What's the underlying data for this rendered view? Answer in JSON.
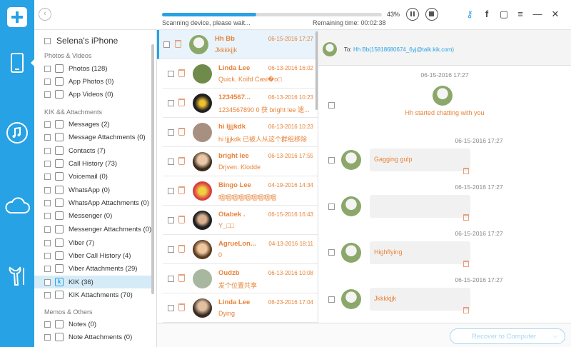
{
  "topbar": {
    "back_glyph": "‹",
    "scan_status": "Scanning device, please wait...",
    "remaining": "Remaining time: 00:02:38",
    "percent": "43%",
    "progress_fraction": 0.43,
    "icons": [
      "key-icon",
      "facebook-icon",
      "feedback-icon",
      "menu-icon",
      "minimize-icon",
      "close-icon"
    ],
    "icon_glyphs": [
      "⚷",
      "f",
      "▢",
      "≡",
      "—",
      "✕"
    ]
  },
  "rail": {
    "items": [
      "phone-icon",
      "music-icon",
      "cloud-icon",
      "tools-icon"
    ],
    "active": 0
  },
  "categories": {
    "device_name": "Selena's iPhone",
    "groups": [
      {
        "title": "Photos & Videos",
        "items": [
          "Photos (128)",
          "App Photos (0)",
          "App Videos (0)"
        ]
      },
      {
        "title": "KIK && Attachments",
        "items": [
          "Messages (2)",
          "Message Attachments (0)",
          "Contacts (7)",
          "Call History (73)",
          "Voicemail (0)",
          "WhatsApp (0)",
          "WhatsApp Attachments (0)",
          "Messenger (0)",
          "Messenger Attachments (0)",
          "Viber (7)",
          "Viber Call History (4)",
          "Viber Attachments (29)",
          "KIK (36)",
          "KIK Attachments (70)"
        ]
      },
      {
        "title": "Memos & Others",
        "items": [
          "Notes (0)",
          "Note Attachments (0)"
        ]
      }
    ],
    "selected": "KIK (36)"
  },
  "messages": [
    {
      "name": "Hh Bb",
      "date": "06-15-2016 17:27",
      "preview": "Jkkkkjjk",
      "active": true
    },
    {
      "name": "Linda Lee",
      "date": "06-13-2016 16:02",
      "preview": "Quick. Koifd Casi�o□"
    },
    {
      "name": "1234567...",
      "date": "06-13-2016 10:23",
      "preview": "1234567890 0 获 bright lee 遗..."
    },
    {
      "name": "hi ljjjkdk",
      "date": "06-13-2016 10:23",
      "preview": "hi ljjjkdk 已被人从这个群组移除"
    },
    {
      "name": "bright lee",
      "date": "06-13-2016 17:55",
      "preview": "Drjven.  Klodde"
    },
    {
      "name": "Bingo Lee",
      "date": "04-19-2016 14:34",
      "preview": "咽咽咽咽咽咽咽咽咽"
    },
    {
      "name": "Otabek .",
      "date": "06-15-2016 16:43",
      "preview": "Y_□□"
    },
    {
      "name": "AgrueLon...",
      "date": "04-13-2016 18:11",
      "preview": "0"
    },
    {
      "name": "Oudzb",
      "date": "06-13-2016 10:08",
      "preview": "发个位置共享"
    },
    {
      "name": "Linda Lee",
      "date": "06-23-2016 17:04",
      "preview": "Dying"
    }
  ],
  "conversation": {
    "to_label": "To:",
    "to_address": "Hh Bb(15818680674_6yj@talk.kik.com)",
    "first_date": "06-15-2016 17:27",
    "started_text": "Hh started chatting with you",
    "bubbles": [
      {
        "date": "06-15-2016 17:27",
        "text": "Gagging gulp"
      },
      {
        "date": "06-15-2016 17:27",
        "text": ""
      },
      {
        "date": "06-15-2016 17:27",
        "text": "Highflying"
      },
      {
        "date": "06-15-2016 17:27",
        "text": "Jkkkkjjk"
      }
    ]
  },
  "bottombar": {
    "recover_label": "Recover to Computer",
    "caret": "⌵"
  },
  "colors": {
    "accent": "#27a2e4",
    "orange_text": "#e8833a"
  }
}
